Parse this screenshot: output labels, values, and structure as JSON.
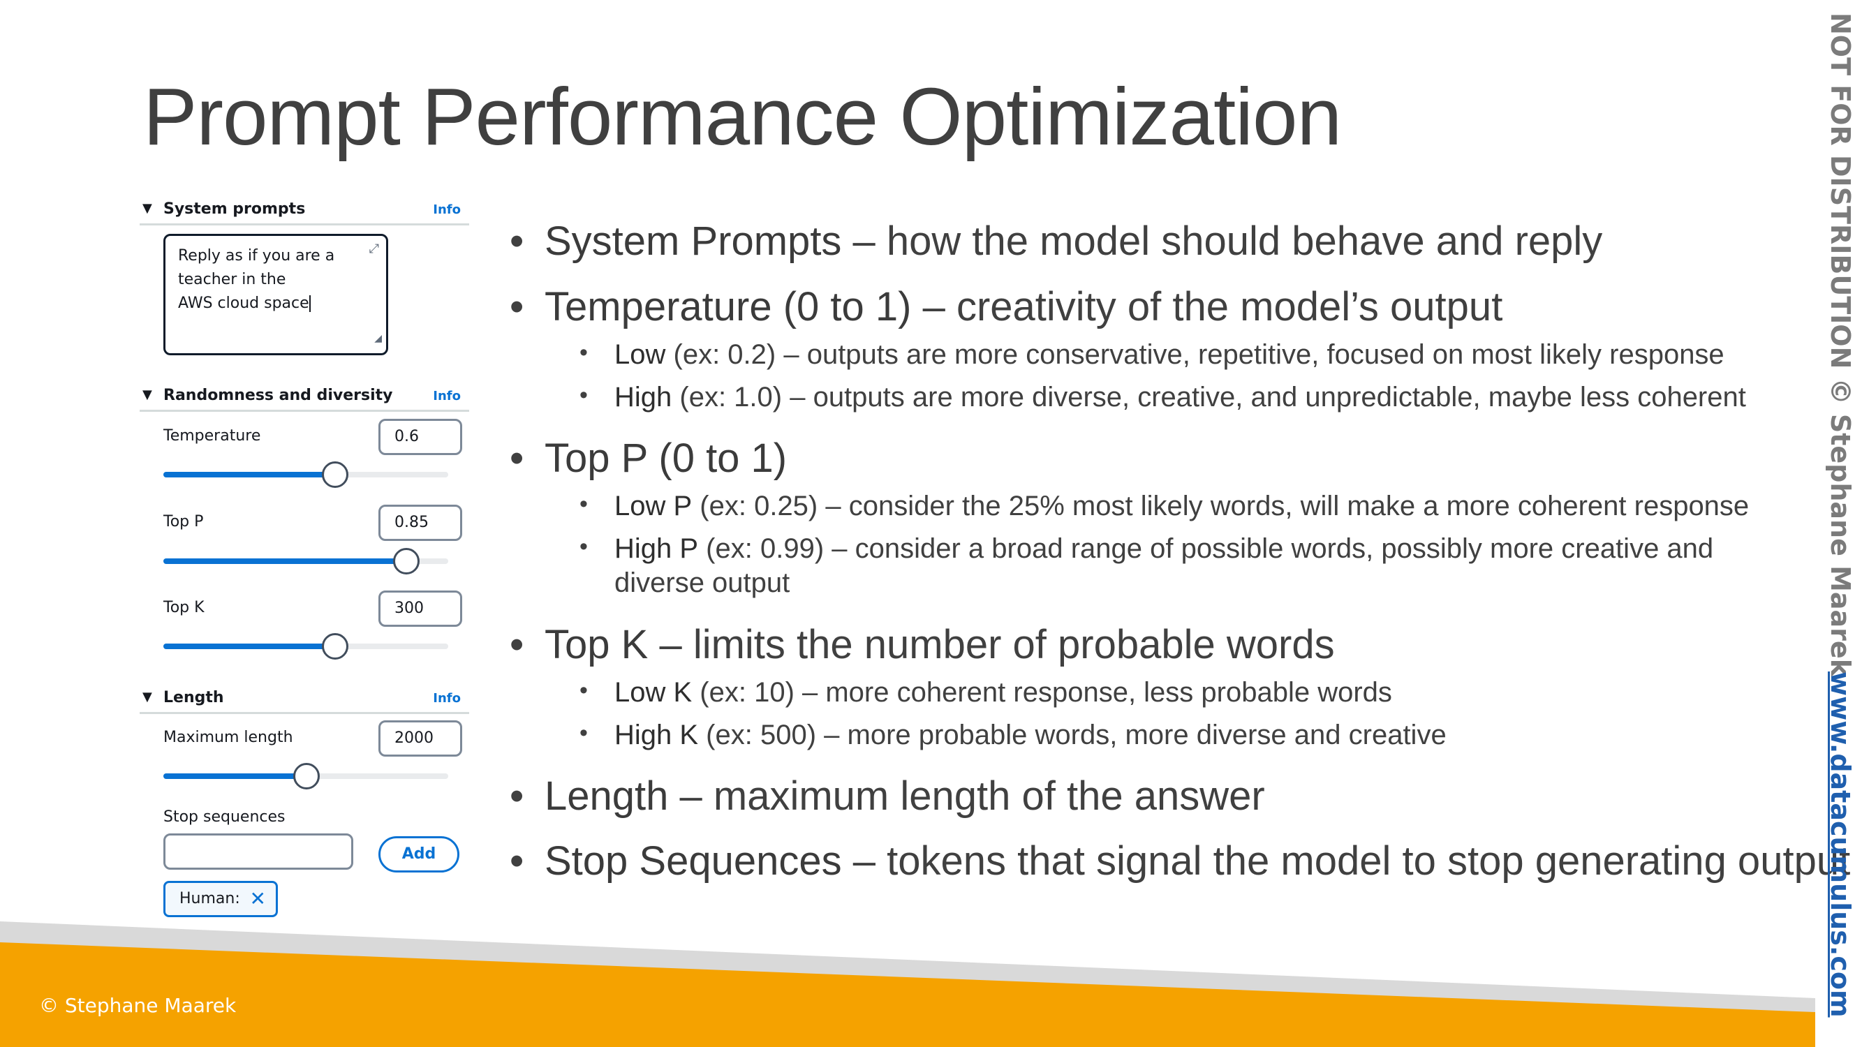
{
  "slide_title": "Prompt Performance Optimization",
  "panel": {
    "system_prompts": {
      "title": "System prompts",
      "info": "Info",
      "text_line1": "Reply as if you are a teacher in the",
      "text_line2": "AWS cloud space"
    },
    "randomness": {
      "title": "Randomness and diversity",
      "info": "Info",
      "temperature": {
        "label": "Temperature",
        "value": "0.6",
        "fraction": 0.6
      },
      "top_p": {
        "label": "Top P",
        "value": "0.85",
        "fraction": 0.85
      },
      "top_k": {
        "label": "Top K",
        "value": "300",
        "fraction": 0.6
      }
    },
    "length": {
      "title": "Length",
      "info": "Info",
      "max_length": {
        "label": "Maximum length",
        "value": "2000",
        "fraction": 0.5
      },
      "stop_sequences_label": "Stop sequences",
      "add_button": "Add",
      "token": "Human:"
    }
  },
  "bullets": {
    "system_prompts": {
      "key": "System Prompts",
      "desc": " – how the model should behave and reply"
    },
    "temperature": {
      "key": "Temperature (0 to 1)",
      "desc": " – creativity of the model’s output",
      "low": {
        "key": "Low",
        "desc": " (ex: 0.2) – outputs are more conservative, repetitive, focused on most likely response"
      },
      "high": {
        "key": "High",
        "desc": " (ex: 1.0) – outputs are more diverse, creative, and unpredictable, maybe less coherent"
      }
    },
    "top_p": {
      "key": "Top P (0 to 1)",
      "low": {
        "key": "Low P",
        "desc": " (ex: 0.25) – consider the 25% most likely words, will make a more coherent response"
      },
      "high": {
        "key": "High P",
        "desc": " (ex: 0.99) – consider a broad range of possible words, possibly more creative and",
        "wrap": "diverse output"
      }
    },
    "top_k": {
      "key": "Top K",
      "desc": " – limits the number of probable words",
      "low": {
        "key": "Low K",
        "desc": " (ex: 10) –  more coherent response, less probable words"
      },
      "high": {
        "key": "High K",
        "desc": " (ex: 500) – more probable words, more diverse and creative"
      }
    },
    "length": {
      "key": "Length",
      "desc": " – maximum length of the answer"
    },
    "stop_sequences": {
      "key": "Stop Sequences",
      "desc": " – tokens that signal the model to stop generating output"
    }
  },
  "watermark": {
    "notice": "NOT FOR DISTRIBUTION © Stephane Maarek",
    "url": "www.datacumulus.com"
  },
  "footer": {
    "copyright": "© Stephane Maarek"
  },
  "colors": {
    "accent_orange": "#f5a200",
    "link_blue": "#0972d3",
    "watermark_blue": "#1f5fae"
  }
}
